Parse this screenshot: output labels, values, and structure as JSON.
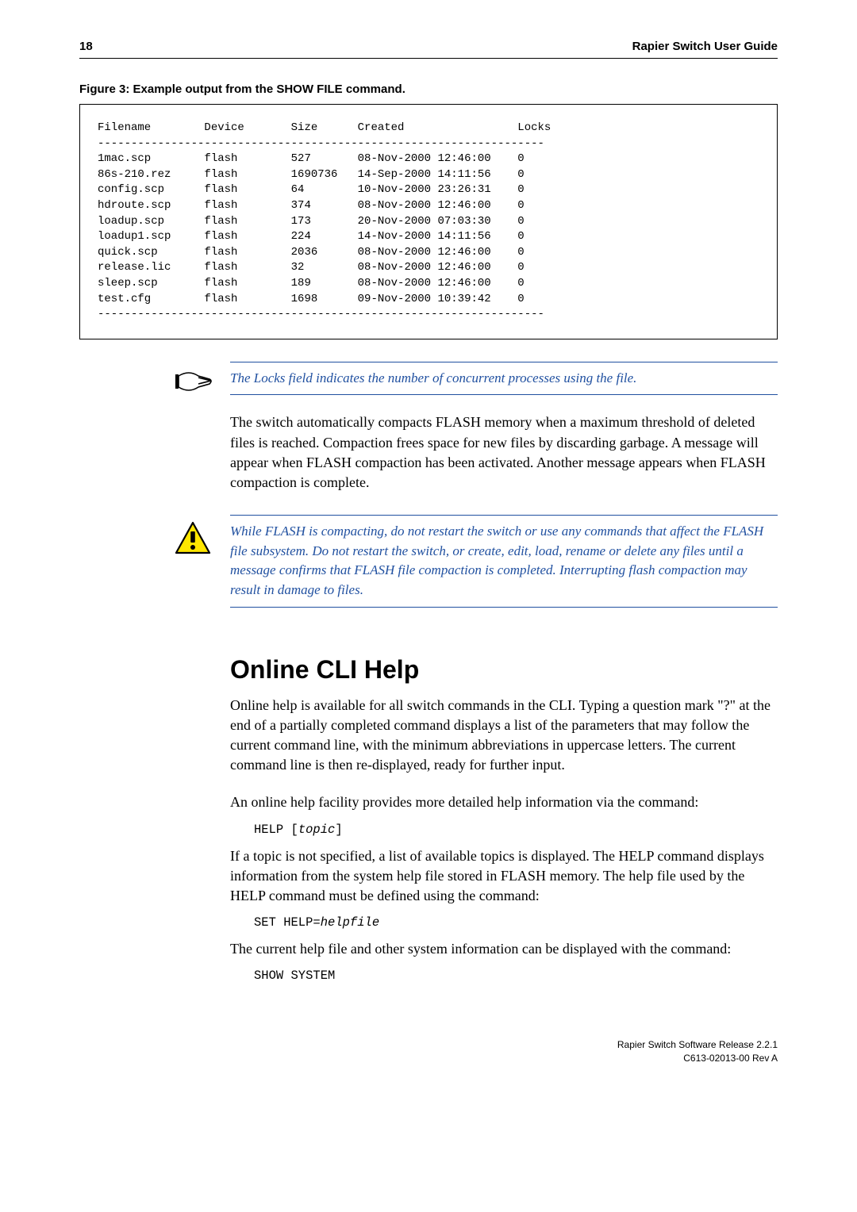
{
  "header": {
    "page_number": "18",
    "title": "Rapier Switch User Guide"
  },
  "figure": {
    "caption": "Figure 3: Example output from the SHOW FILE command.",
    "columns": [
      "Filename",
      "Device",
      "Size",
      "Created",
      "Locks"
    ],
    "rule": "-------------------------------------------------------------------",
    "rows": [
      [
        "1mac.scp",
        "flash",
        "527",
        "08-Nov-2000 12:46:00",
        "0"
      ],
      [
        "86s-210.rez",
        "flash",
        "1690736",
        "14-Sep-2000 14:11:56",
        "0"
      ],
      [
        "config.scp",
        "flash",
        "64",
        "10-Nov-2000 23:26:31",
        "0"
      ],
      [
        "hdroute.scp",
        "flash",
        "374",
        "08-Nov-2000 12:46:00",
        "0"
      ],
      [
        "loadup.scp",
        "flash",
        "173",
        "20-Nov-2000 07:03:30",
        "0"
      ],
      [
        "loadup1.scp",
        "flash",
        "224",
        "14-Nov-2000 14:11:56",
        "0"
      ],
      [
        "quick.scp",
        "flash",
        "2036",
        "08-Nov-2000 12:46:00",
        "0"
      ],
      [
        "release.lic",
        "flash",
        "32",
        "08-Nov-2000 12:46:00",
        "0"
      ],
      [
        "sleep.scp",
        "flash",
        "189",
        "08-Nov-2000 12:46:00",
        "0"
      ],
      [
        "test.cfg",
        "flash",
        "1698",
        "09-Nov-2000 10:39:42",
        "0"
      ]
    ]
  },
  "note1": "The Locks field indicates the number of concurrent processes using the file.",
  "para1": "The switch automatically compacts FLASH memory when a maximum threshold of deleted files is reached. Compaction frees space for new files by discarding garbage. A message will appear when FLASH compaction has been activated. Another message appears when FLASH compaction is complete.",
  "warning": "While FLASH is compacting, do not restart the switch or use any commands that affect the FLASH file subsystem. Do not restart the switch, or create, edit, load, rename or delete any files until a message confirms that FLASH file compaction is completed. Interrupting flash compaction may result in damage to files.",
  "section_heading": "Online CLI Help",
  "para2": "Online help is available for all switch commands in the CLI. Typing a question mark \"?\" at the end of a partially completed command displays a list of the parameters that may follow the current command line, with the minimum abbreviations in uppercase letters. The current command line is then re-displayed, ready for further input.",
  "para3": "An online help facility provides more detailed help information via the command:",
  "cmd1": {
    "text": "HELP [",
    "arg": "topic",
    "suffix": "]"
  },
  "para4": "If a topic is not specified, a list of available topics is displayed. The HELP command displays information from the system help file stored in FLASH memory. The help file used by the HELP command must be defined using the command:",
  "cmd2": {
    "text": "SET HELP=",
    "arg": "helpfile",
    "suffix": ""
  },
  "para5": "The current help file and other system information can be displayed with the command:",
  "cmd3": {
    "text": "SHOW SYSTEM",
    "arg": "",
    "suffix": ""
  },
  "footer": {
    "line1": "Rapier Switch Software Release 2.2.1",
    "line2": "C613-02013-00 Rev A"
  }
}
